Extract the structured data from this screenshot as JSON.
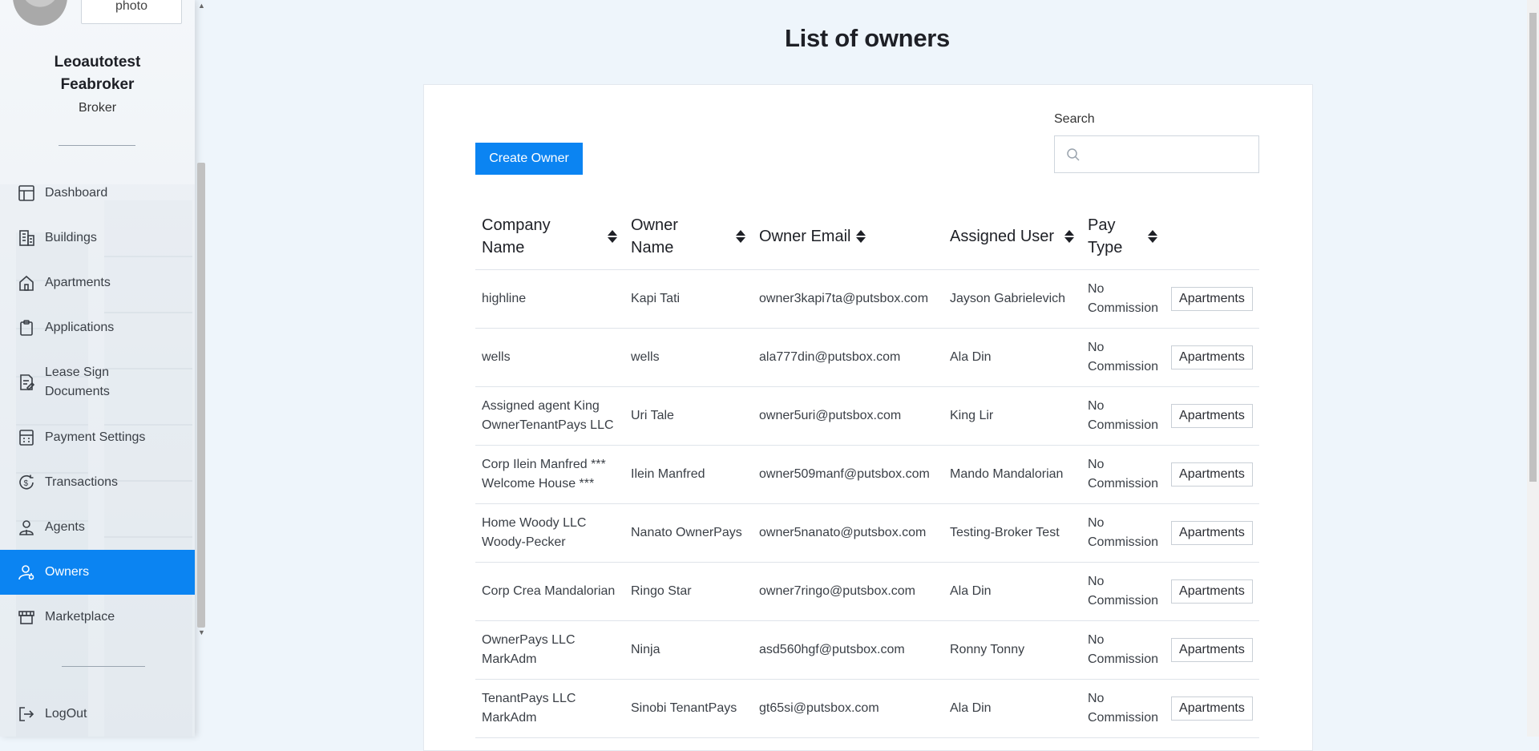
{
  "profile": {
    "photo_label": "photo",
    "name_line1": "Leoautotest",
    "name_line2": "Feabroker",
    "role": "Broker"
  },
  "nav": [
    {
      "label": "Dashboard",
      "icon": "layout-icon"
    },
    {
      "label": "Buildings",
      "icon": "buildings-icon"
    },
    {
      "label": "Apartments",
      "icon": "home-icon"
    },
    {
      "label": "Applications",
      "icon": "clipboard-icon"
    },
    {
      "label": "Lease Sign\nDocuments",
      "icon": "document-sign-icon"
    },
    {
      "label": "Payment Settings",
      "icon": "calculator-icon"
    },
    {
      "label": "Transactions",
      "icon": "dollar-cycle-icon"
    },
    {
      "label": "Agents",
      "icon": "agent-icon"
    },
    {
      "label": "Owners",
      "icon": "owner-icon",
      "active": true
    },
    {
      "label": "Marketplace",
      "icon": "marketplace-icon"
    }
  ],
  "logout_label": "LogOut",
  "page_title": "List of owners",
  "create_button": "Create Owner",
  "search": {
    "label": "Search",
    "placeholder": ""
  },
  "table": {
    "headers": [
      "Company Name",
      "Owner Name",
      "Owner Email",
      "Assigned User",
      "Pay Type"
    ],
    "action_label": "Apartments",
    "rows": [
      {
        "company": "highline",
        "owner": "Kapi Tati",
        "email": "owner3kapi7ta@putsbox.com",
        "user": "Jayson Gabrielevich",
        "pay": "No Commission"
      },
      {
        "company": "wells",
        "owner": "wells",
        "email": "ala777din@putsbox.com",
        "user": "Ala Din",
        "pay": "No Commission"
      },
      {
        "company": "Assigned agent King OwnerTenantPays LLC",
        "owner": "Uri Tale",
        "email": "owner5uri@putsbox.com",
        "user": "King Lir",
        "pay": "No Commission"
      },
      {
        "company": "Corp Ilein Manfred *** Welcome House ***",
        "owner": "Ilein Manfred",
        "email": "owner509manf@putsbox.com",
        "user": "Mando Mandalorian",
        "pay": "No Commission"
      },
      {
        "company": "Home Woody LLC Woody-Pecker",
        "owner": "Nanato OwnerPays",
        "email": "owner5nanato@putsbox.com",
        "user": "Testing-Broker Test",
        "pay": "No Commission"
      },
      {
        "company": "Corp Crea Mandalorian",
        "owner": "Ringo Star",
        "email": "owner7ringo@putsbox.com",
        "user": "Ala Din",
        "pay": "No Commission"
      },
      {
        "company": "OwnerPays LLC MarkAdm",
        "owner": "Ninja",
        "email": "asd560hgf@putsbox.com",
        "user": "Ronny Tonny",
        "pay": "No Commission"
      },
      {
        "company": "TenantPays LLC MarkAdm",
        "owner": "Sinobi TenantPays",
        "email": "gt65si@putsbox.com",
        "user": "Ala Din",
        "pay": "No Commission"
      }
    ]
  },
  "colors": {
    "accent": "#0b84f2",
    "background": "#eef5fb"
  }
}
